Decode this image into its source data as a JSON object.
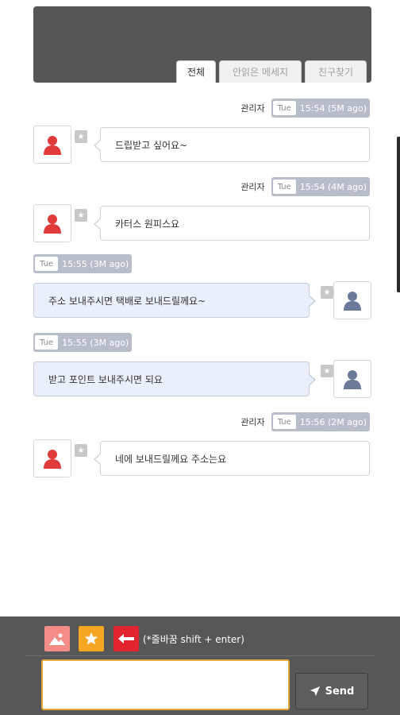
{
  "tabs": [
    {
      "label": "전체",
      "active": true
    },
    {
      "label": "안읽은 메세지",
      "active": false
    },
    {
      "label": "친구찾기",
      "active": false
    }
  ],
  "messages": [
    {
      "direction": "in",
      "sender": "관리자",
      "day": "Tue",
      "time": "15:54 (5M ago)",
      "text": "드립받고 싶어요~"
    },
    {
      "direction": "in",
      "sender": "관리자",
      "day": "Tue",
      "time": "15:54 (4M ago)",
      "text": "카터스 원피스요"
    },
    {
      "direction": "out",
      "sender": "",
      "day": "Tue",
      "time": "15:55 (3M ago)",
      "text": "주소 보내주시면 택배로 보내드릴께요~"
    },
    {
      "direction": "out",
      "sender": "",
      "day": "Tue",
      "time": "15:55 (3M ago)",
      "text": "받고 포인트 보내주시면 되요"
    },
    {
      "direction": "in",
      "sender": "관리자",
      "day": "Tue",
      "time": "15:56 (2M ago)",
      "text": "네에 보내드릴께요 주소는요"
    }
  ],
  "composer": {
    "hint": "(*줄바꿈 shift + enter)",
    "input_value": "",
    "send_label": "Send",
    "tools": [
      "image-icon",
      "star-icon",
      "back-arrow-icon"
    ]
  },
  "colors": {
    "header": "#565656",
    "incoming_avatar": "#e23b3b",
    "outgoing_avatar": "#6b7a99",
    "outgoing_bubble": "#e9f0fb",
    "time_badge": "#b8bdca",
    "bottom_bar": "#575757",
    "input_border": "#e7a93b"
  }
}
